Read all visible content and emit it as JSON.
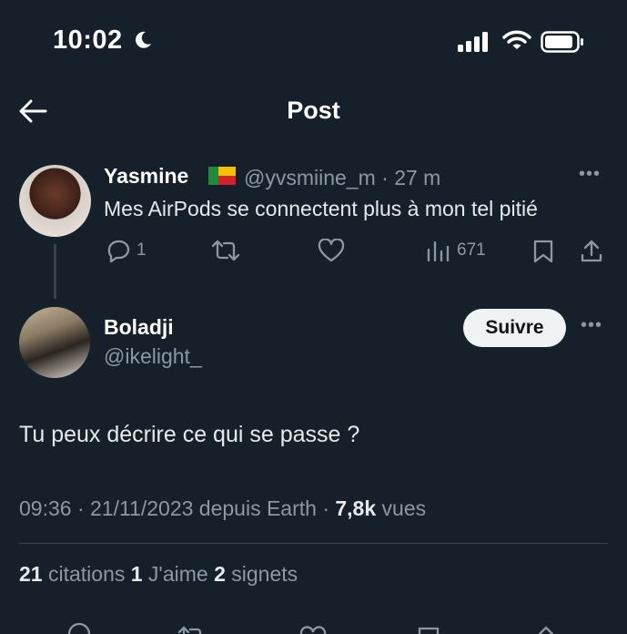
{
  "status_bar": {
    "time": "10:02"
  },
  "header": {
    "title": "Post"
  },
  "parent_tweet": {
    "name": "Yasmine",
    "handle": "@yvsmiine_m",
    "time": "27 m",
    "meta": "@yvsmiine_m · 27 m",
    "text": "Mes AirPods se connectent plus à mon tel pitié",
    "replies": "1",
    "views": "671"
  },
  "reply": {
    "name": "Boladji",
    "handle": "@ikelight_",
    "follow_label": "Suivre",
    "text": "Tu peux décrire ce qui se passe ?",
    "timestamp": "09:36 · 21/11/2023 depuis Earth · ",
    "views_count": "7,8k",
    "views_label": " vues",
    "quotes_count": "21",
    "quotes_label": " citations ",
    "likes_count": "1",
    "likes_label": " J'aime ",
    "bookmarks_count": "2",
    "bookmarks_label": " signets"
  }
}
